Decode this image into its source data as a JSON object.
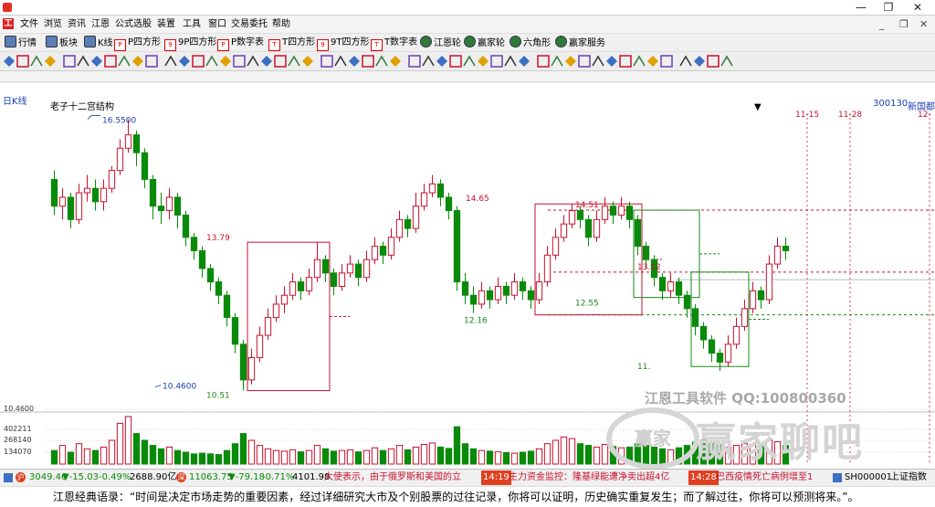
{
  "titlebar": {
    "title": "",
    "min": "—",
    "max": "❐",
    "close": "✕"
  },
  "menu": {
    "items": [
      "文件",
      "浏览",
      "资讯",
      "江恩",
      "公式选股",
      "装置",
      "工具",
      "窗口",
      "交易委托",
      "帮助"
    ],
    "mdi_min": "_",
    "mdi_max": "❐",
    "mdi_close": "✕"
  },
  "toolbar1": {
    "items": [
      "行情",
      "板块",
      "K线",
      "P四方形",
      "9P四方形",
      "P数字表",
      "T四方形",
      "9T四方形",
      "T数字表",
      "江恩轮",
      "赢家轮",
      "六角形",
      "赢家服务"
    ]
  },
  "chart": {
    "period_label": "日K线",
    "code_label": "300130",
    "name_label": "新国都",
    "indicator_title": "老子十二宫结构",
    "date_ticks": [],
    "future_dates": [
      "11-15",
      "11-28",
      "12-"
    ],
    "watermark_line1": "江恩工具软件  QQ:100800360",
    "watermark_logo": "赢家聊吧"
  },
  "chart_data": {
    "type": "candlestick",
    "title": "老子十二宫结构",
    "price_annotations": [
      {
        "label": "16.5500",
        "value": 16.55
      },
      {
        "label": "13.79",
        "value": 13.79
      },
      {
        "label": "10.4600",
        "value": 10.46
      },
      {
        "label": "10.51",
        "value": 10.51
      },
      {
        "label": "14.65",
        "value": 14.65
      },
      {
        "label": "14.51",
        "value": 14.51
      },
      {
        "label": "13.12",
        "value": 13.12
      },
      {
        "label": "12.55",
        "value": 12.55
      },
      {
        "label": "12.16",
        "value": 12.16
      },
      {
        "label": "11.",
        "value": 11.0
      }
    ],
    "price_range": [
      10.0,
      17.3
    ],
    "volume_ticks": [
      "10.4600",
      "402211",
      "268140",
      "134070"
    ],
    "candles": [
      [
        15.2,
        14.6,
        15.4,
        14.4
      ],
      [
        14.6,
        14.8,
        15.0,
        14.3
      ],
      [
        14.8,
        14.3,
        14.9,
        14.1
      ],
      [
        14.3,
        14.9,
        15.1,
        14.2
      ],
      [
        14.9,
        15.0,
        15.3,
        14.7
      ],
      [
        15.0,
        14.7,
        15.2,
        14.5
      ],
      [
        14.7,
        15.0,
        15.2,
        14.5
      ],
      [
        15.0,
        15.4,
        15.5,
        14.9
      ],
      [
        15.4,
        15.9,
        16.1,
        15.3
      ],
      [
        15.9,
        16.2,
        16.55,
        15.8
      ],
      [
        16.2,
        15.8,
        16.3,
        15.5
      ],
      [
        15.8,
        15.2,
        15.9,
        15.0
      ],
      [
        15.2,
        14.6,
        15.3,
        14.3
      ],
      [
        14.6,
        14.5,
        14.9,
        14.2
      ],
      [
        14.5,
        14.8,
        15.0,
        14.3
      ],
      [
        14.8,
        14.4,
        14.9,
        14.1
      ],
      [
        14.4,
        13.9,
        14.5,
        13.7
      ],
      [
        13.9,
        13.6,
        14.0,
        13.4
      ],
      [
        13.6,
        13.2,
        13.7,
        13.0
      ],
      [
        13.2,
        12.9,
        13.3,
        12.7
      ],
      [
        12.9,
        12.6,
        13.0,
        12.4
      ],
      [
        12.6,
        12.1,
        12.7,
        11.9
      ],
      [
        12.1,
        11.5,
        12.2,
        11.3
      ],
      [
        11.5,
        10.7,
        11.6,
        10.46
      ],
      [
        10.7,
        11.2,
        11.4,
        10.6
      ],
      [
        11.2,
        11.7,
        11.9,
        11.1
      ],
      [
        11.7,
        12.1,
        12.3,
        11.6
      ],
      [
        12.1,
        12.4,
        12.6,
        12.0
      ],
      [
        12.4,
        12.6,
        12.8,
        12.2
      ],
      [
        12.6,
        12.9,
        13.1,
        12.5
      ],
      [
        12.9,
        12.7,
        13.0,
        12.5
      ],
      [
        12.7,
        13.0,
        13.2,
        12.6
      ],
      [
        13.0,
        13.4,
        13.79,
        12.9
      ],
      [
        13.4,
        13.1,
        13.5,
        12.9
      ],
      [
        13.1,
        12.8,
        13.2,
        12.6
      ],
      [
        12.8,
        13.1,
        13.3,
        12.7
      ],
      [
        13.1,
        13.3,
        13.5,
        13.0
      ],
      [
        13.3,
        13.0,
        13.4,
        12.8
      ],
      [
        13.0,
        13.4,
        13.6,
        12.9
      ],
      [
        13.4,
        13.7,
        13.9,
        13.3
      ],
      [
        13.7,
        13.5,
        13.8,
        13.3
      ],
      [
        13.5,
        13.9,
        14.1,
        13.4
      ],
      [
        13.9,
        14.3,
        14.5,
        13.8
      ],
      [
        14.3,
        14.1,
        14.4,
        13.9
      ],
      [
        14.1,
        14.6,
        14.9,
        14.0
      ],
      [
        14.6,
        14.9,
        15.1,
        14.5
      ],
      [
        14.9,
        15.1,
        15.3,
        14.8
      ],
      [
        15.1,
        14.8,
        15.2,
        14.6
      ],
      [
        14.8,
        14.5,
        14.9,
        14.3
      ],
      [
        14.5,
        12.9,
        14.6,
        12.7
      ],
      [
        12.9,
        12.6,
        13.1,
        12.4
      ],
      [
        12.6,
        12.4,
        12.8,
        12.2
      ],
      [
        12.4,
        12.7,
        12.9,
        12.3
      ],
      [
        12.7,
        12.5,
        12.8,
        12.3
      ],
      [
        12.5,
        12.8,
        13.0,
        12.4
      ],
      [
        12.8,
        12.6,
        12.9,
        12.4
      ],
      [
        12.6,
        12.9,
        13.1,
        12.5
      ],
      [
        12.9,
        12.7,
        13.0,
        12.5
      ],
      [
        12.7,
        12.5,
        12.8,
        12.3
      ],
      [
        12.5,
        12.9,
        13.1,
        12.4
      ],
      [
        12.9,
        13.5,
        13.7,
        12.8
      ],
      [
        13.5,
        13.9,
        14.1,
        13.4
      ],
      [
        13.9,
        14.2,
        14.4,
        13.8
      ],
      [
        14.2,
        14.5,
        14.65,
        14.1
      ],
      [
        14.5,
        14.3,
        14.6,
        14.1
      ],
      [
        14.3,
        13.9,
        14.4,
        13.7
      ],
      [
        13.9,
        14.3,
        14.5,
        13.8
      ],
      [
        14.3,
        14.6,
        14.8,
        14.2
      ],
      [
        14.6,
        14.4,
        14.7,
        14.2
      ],
      [
        14.4,
        14.6,
        14.8,
        14.3
      ],
      [
        14.6,
        14.3,
        14.7,
        14.1
      ],
      [
        14.3,
        13.7,
        14.4,
        13.5
      ],
      [
        13.7,
        13.4,
        13.8,
        13.2
      ],
      [
        13.4,
        13.0,
        13.5,
        12.8
      ],
      [
        13.0,
        12.7,
        13.1,
        12.5
      ],
      [
        12.7,
        12.9,
        13.1,
        12.55
      ],
      [
        12.9,
        12.6,
        13.0,
        12.4
      ],
      [
        12.6,
        12.3,
        12.7,
        12.1
      ],
      [
        12.3,
        11.9,
        12.4,
        11.7
      ],
      [
        11.9,
        11.6,
        12.0,
        11.4
      ],
      [
        11.6,
        11.3,
        11.7,
        11.1
      ],
      [
        11.3,
        11.1,
        11.4,
        10.9
      ],
      [
        11.1,
        11.5,
        11.7,
        11.0
      ],
      [
        11.5,
        11.9,
        12.1,
        11.4
      ],
      [
        11.9,
        12.3,
        12.5,
        11.8
      ],
      [
        12.3,
        12.7,
        12.9,
        12.2
      ],
      [
        12.7,
        12.5,
        12.8,
        12.3
      ],
      [
        12.5,
        13.3,
        13.5,
        12.4
      ],
      [
        13.3,
        13.7,
        13.9,
        13.2
      ],
      [
        13.7,
        13.6,
        13.9,
        13.4
      ]
    ],
    "volumes": [
      40,
      55,
      35,
      60,
      45,
      40,
      50,
      70,
      120,
      140,
      90,
      70,
      55,
      45,
      50,
      40,
      35,
      30,
      32,
      30,
      28,
      40,
      60,
      90,
      70,
      55,
      45,
      40,
      38,
      42,
      36,
      40,
      55,
      45,
      38,
      40,
      42,
      36,
      40,
      48,
      40,
      45,
      55,
      42,
      50,
      58,
      62,
      50,
      46,
      110,
      60,
      45,
      40,
      38,
      36,
      34,
      32,
      35,
      38,
      45,
      60,
      70,
      80,
      75,
      60,
      55,
      50,
      58,
      52,
      48,
      50,
      60,
      55,
      50,
      45,
      42,
      48,
      55,
      65,
      70,
      60,
      58,
      50,
      55,
      60,
      58,
      62,
      70,
      66,
      55
    ],
    "boxes": [
      {
        "from": 24,
        "to": 33,
        "lo": 10.46,
        "hi": 13.79,
        "color": "#c8102e"
      },
      {
        "from": 59,
        "to": 71,
        "lo": 12.16,
        "hi": 14.65,
        "color": "#c8102e"
      },
      {
        "from": 71,
        "to": 78,
        "lo": 12.55,
        "hi": 14.51,
        "color": "#1a8a1a"
      },
      {
        "from": 78,
        "to": 84,
        "lo": 11.0,
        "hi": 13.12,
        "color": "#1a8a1a"
      }
    ],
    "hlines": [
      {
        "value": 14.51,
        "color": "#c8102e",
        "dash": "3,3"
      },
      {
        "value": 13.12,
        "color": "#c8102e",
        "dash": "3,3"
      },
      {
        "value": 12.16,
        "color": "#1a8a1a",
        "dash": "3,3"
      }
    ]
  },
  "statusbar": {
    "sh_val": "3049.46",
    "sh_chg": "▼-15.03",
    "sh_pct": "-0.49%",
    "sh_amt": "2688.90亿",
    "sz_val": "11063.75",
    "sz_chg": "▼-79.18",
    "sz_pct": "-0.71%",
    "sz_amt": "4101.98",
    "news1": "大使表示，由于俄罗斯和美国的立",
    "news1_time": "14:19",
    "news2": "主力资金监控：隆基绿能遭净卖出超4亿",
    "news2_time": "14:28",
    "news3": "巴西疫情死亡病例增至1",
    "right_code": "SH000001",
    "right_name": "上证指数"
  },
  "quote": {
    "text": "江恩经典语录：“时间是决定市场走势的重要因素，经过详细研究大市及个别股票的过往记录，你将可以证明，历史确实重复发生；而了解过往，你将可以预测将来。”。"
  },
  "colors": {
    "up": "#c8102e",
    "down": "#0a8a0a",
    "accent": "#d22"
  }
}
